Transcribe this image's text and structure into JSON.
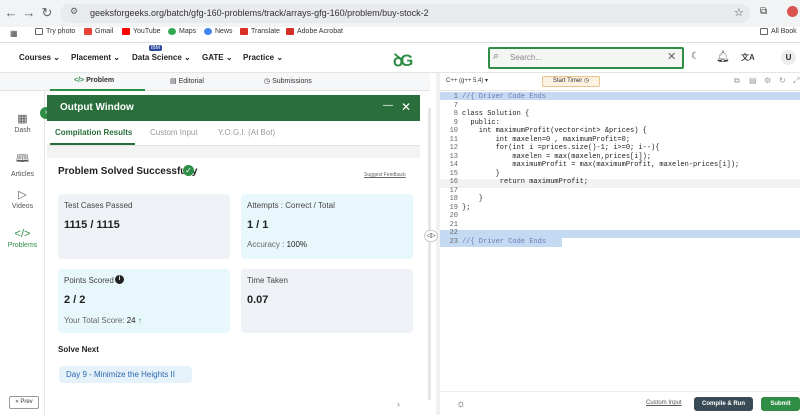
{
  "browser": {
    "url": "geeksforgeeks.org/batch/gfg-160-problems/track/arrays-gfg-160/problem/buy-stock-2",
    "bookmarks": [
      "Try photo",
      "Gmail",
      "YouTube",
      "Maps",
      "News",
      "Translate",
      "Adobe Acrobat",
      "All Book"
    ]
  },
  "site": {
    "logo": "ꝺG",
    "ibm_badge": "IBM",
    "nav": [
      "Courses",
      "Placement",
      "Data Science",
      "GATE",
      "Practice"
    ],
    "search_placeholder": "Search...",
    "avatar": "U"
  },
  "problem_tabs": [
    "Problem",
    "Editorial",
    "Submissions"
  ],
  "sidebar": {
    "items": [
      "Dash",
      "Articles",
      "Videos",
      "Problems"
    ],
    "prev": "« Prev"
  },
  "output": {
    "title": "Output Window",
    "tabs": [
      "Compilation Results",
      "Custom Input",
      "Y.O.G.I. (AI Bot)"
    ],
    "status": "Problem Solved Successfully",
    "feedback": "Suggest Feedback",
    "cards": {
      "tests_label": "Test Cases Passed",
      "tests_value": "1115 / 1115",
      "attempts_label": "Attempts : Correct / Total",
      "attempts_value": "1 / 1",
      "accuracy_label": "Accuracy :",
      "accuracy_value": "100%",
      "points_label": "Points Scored",
      "points_value": "2 / 2",
      "total_label": "Your Total Score:",
      "total_value": "24",
      "time_label": "Time Taken",
      "time_value": "0.07"
    },
    "solve_next_label": "Solve Next",
    "solve_next_item": "Day 9 - Minimize the Heights II"
  },
  "editor": {
    "language": "C++ (g++ 5.4)",
    "timer": "Start Timer",
    "line_numbers": [
      "1",
      "7",
      "8",
      "9",
      "10",
      "11",
      "12",
      "13",
      "14",
      "15",
      "16",
      "17",
      "18",
      "19",
      "20",
      "21",
      "22",
      "23"
    ],
    "lines": [
      "//{ Driver Code Ends",
      "",
      "class Solution {",
      "  public:",
      "    int maximumProfit(vector<int> &prices) {",
      "        int maxelen=0 , maximumProfit=0;",
      "        for(int i =prices.size()-1; i>=0; i--){",
      "            maxelen = max(maxelen,prices[i]);",
      "            maximumProfit = max(maximumProfit, maxelen-prices[i]);",
      "        }",
      "         return maximumProfit;",
      "",
      "    }",
      "};",
      "",
      "",
      "",
      "//{ Driver Code Ends"
    ],
    "custom_input": "Custom Input",
    "compile_run": "Compile & Run",
    "submit": "Submit"
  }
}
